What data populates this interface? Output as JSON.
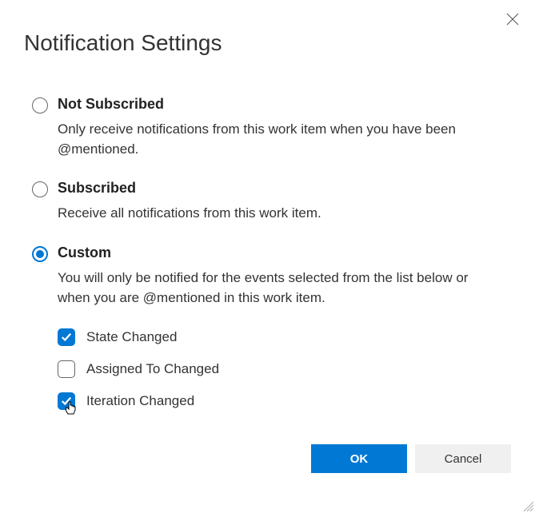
{
  "title": "Notification Settings",
  "options": {
    "not_subscribed": {
      "label": "Not Subscribed",
      "description": "Only receive notifications from this work item when you have been @mentioned.",
      "selected": false
    },
    "subscribed": {
      "label": "Subscribed",
      "description": "Receive all notifications from this work item.",
      "selected": false
    },
    "custom": {
      "label": "Custom",
      "description": "You will only be notified for the events selected from the list below or when you are @mentioned in this work item.",
      "selected": true,
      "events": [
        {
          "label": "State Changed",
          "checked": true
        },
        {
          "label": "Assigned To Changed",
          "checked": false
        },
        {
          "label": "Iteration Changed",
          "checked": true
        }
      ]
    }
  },
  "buttons": {
    "ok": "OK",
    "cancel": "Cancel"
  }
}
